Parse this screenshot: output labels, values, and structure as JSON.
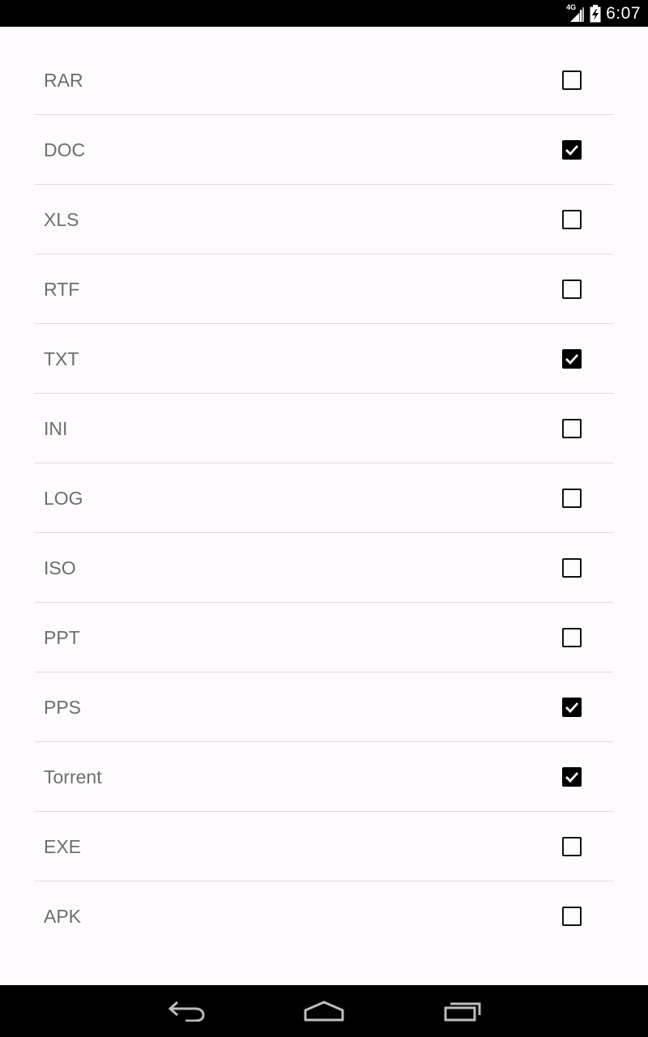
{
  "status_bar": {
    "network": "4G",
    "time": "6:07"
  },
  "file_types": [
    {
      "label": "RAR",
      "checked": false
    },
    {
      "label": "DOC",
      "checked": true
    },
    {
      "label": "XLS",
      "checked": false
    },
    {
      "label": "RTF",
      "checked": false
    },
    {
      "label": "TXT",
      "checked": true
    },
    {
      "label": "INI",
      "checked": false
    },
    {
      "label": "LOG",
      "checked": false
    },
    {
      "label": "ISO",
      "checked": false
    },
    {
      "label": "PPT",
      "checked": false
    },
    {
      "label": "PPS",
      "checked": true
    },
    {
      "label": "Torrent",
      "checked": true
    },
    {
      "label": "EXE",
      "checked": false
    },
    {
      "label": "APK",
      "checked": false
    }
  ],
  "nav_bar": {
    "icons": [
      "back-icon",
      "home-icon",
      "recent-apps-icon"
    ]
  }
}
